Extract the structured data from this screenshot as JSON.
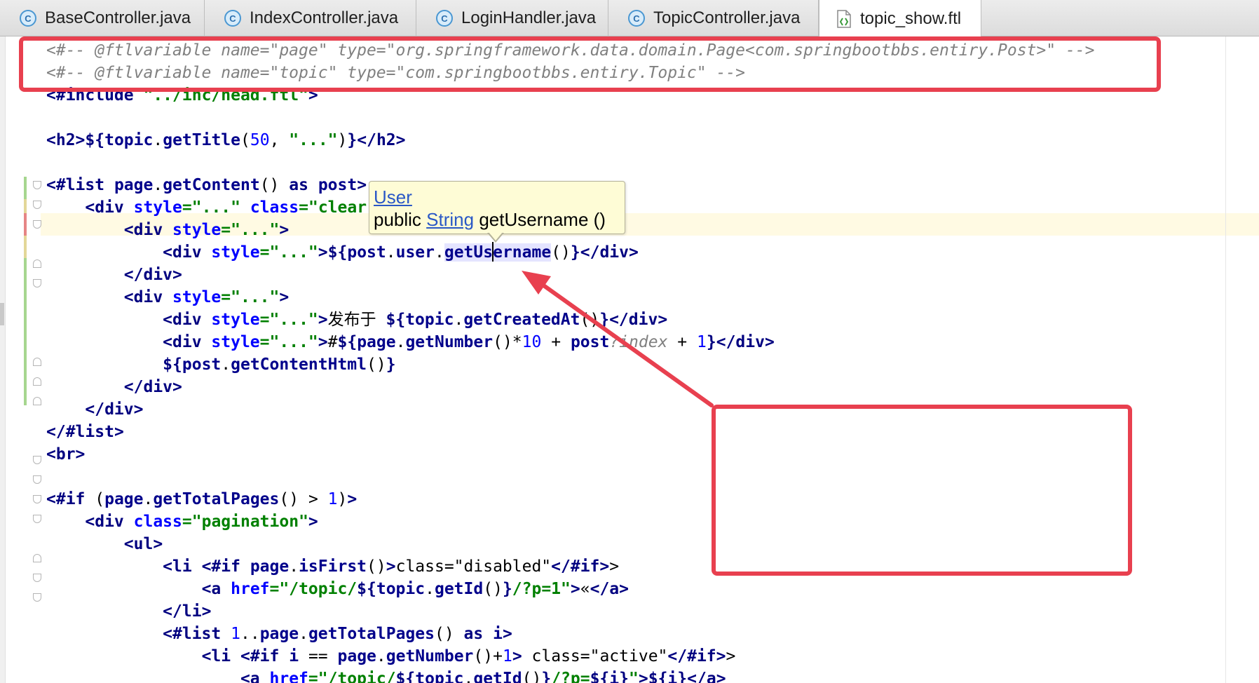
{
  "tabs": [
    {
      "label": "BaseController.java",
      "icon": "java-class-icon",
      "active": false
    },
    {
      "label": "IndexController.java",
      "icon": "java-class-icon",
      "active": false
    },
    {
      "label": "LoginHandler.java",
      "icon": "java-class-icon",
      "active": false
    },
    {
      "label": "TopicController.java",
      "icon": "java-class-icon",
      "active": false
    },
    {
      "label": "topic_show.ftl",
      "icon": "ftl-file-icon",
      "active": true
    }
  ],
  "tab_icon_letter": "C",
  "code_lines": [
    "<#-- @ftlvariable name=\"page\" type=\"org.springframework.data.domain.Page<com.springbootbbs.entiry.Post>\" -->",
    "<#-- @ftlvariable name=\"topic\" type=\"com.springbootbbs.entiry.Topic\" -->",
    "<#include \"../inc/head.ftl\">",
    "",
    "<h2>${topic.getTitle(50, \"...\")}</h2>",
    "",
    "<#list page.getContent() as post>",
    "    <div style=\"...\" class=\"clear",
    "        <div style=\"...\">",
    "            <div style=\"...\">${post.user.getUsername()}</div>",
    "        </div>",
    "        <div style=\"...\">",
    "            <div style=\"...\">发布于 ${topic.getCreatedAt()}</div>",
    "            <div style=\"...\">#${page.getNumber()*10 + post?index + 1}</div>",
    "            ${post.getContentHtml()}",
    "        </div>",
    "    </div>",
    "</#list>",
    "<br>",
    "",
    "<#if (page.getTotalPages() > 1)>",
    "    <div class=\"pagination\">",
    "        <ul>",
    "            <li <#if page.isFirst()>class=\"disabled\"</#if>>",
    "                <a href=\"/topic/${topic.getId()}/?p=1\">«</a>",
    "            </li>",
    "            <#list 1..page.getTotalPages() as i>",
    "                <li <#if i == page.getNumber()+1> class=\"active\"</#if>>",
    "                    <a href=\"/topic/${topic.getId()}/?p=${i}\">${i}</a>"
  ],
  "tooltip": {
    "type_link": "User",
    "modifier": "public",
    "return_type": "String",
    "method": "getUsername ()"
  },
  "colors": {
    "annotation": "#e8404f",
    "tooltip_bg": "#fefcd6",
    "tag": "#000080",
    "attr": "#0000ff",
    "string": "#008000",
    "comment": "#808080"
  }
}
